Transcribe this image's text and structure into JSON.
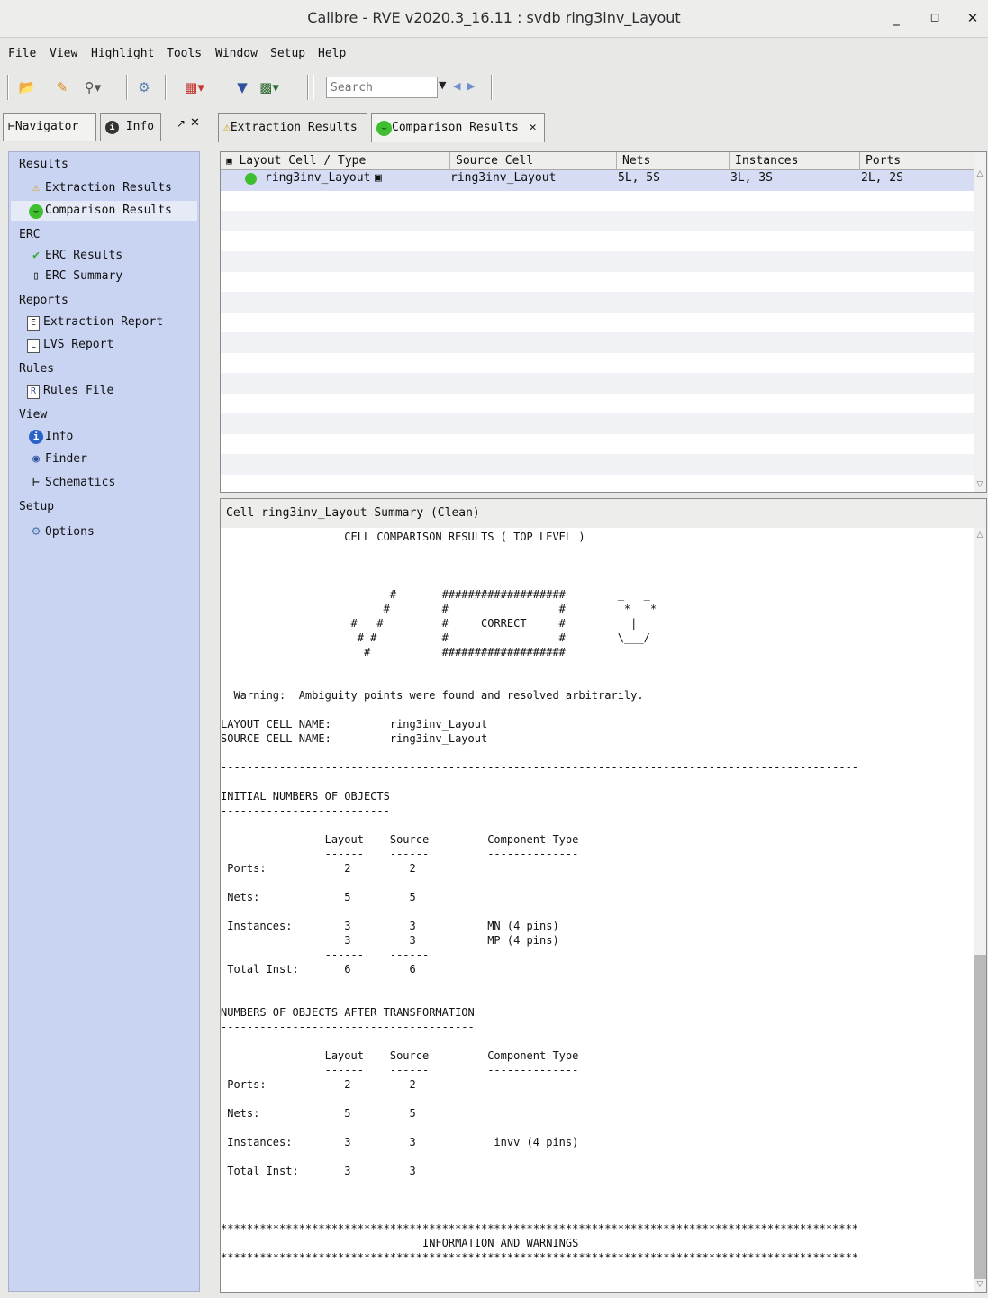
{
  "window": {
    "title": "Calibre - RVE v2020.3_16.11 : svdb ring3inv_Layout",
    "buttons": {
      "minimize": "_",
      "maximize": "◻",
      "close": "✕"
    }
  },
  "menu": [
    "File",
    "View",
    "Highlight",
    "Tools",
    "Window",
    "Setup",
    "Help"
  ],
  "toolbar": {
    "search_placeholder": "Search"
  },
  "left_tabs": {
    "navigator": "Navigator",
    "info": "Info"
  },
  "navigator": {
    "sections": [
      {
        "label": "Results",
        "items": [
          "Extraction Results",
          "Comparison Results"
        ]
      },
      {
        "label": "ERC",
        "items": [
          "ERC Results",
          "ERC Summary"
        ]
      },
      {
        "label": "Reports",
        "items": [
          "Extraction Report",
          "LVS Report"
        ]
      },
      {
        "label": "Rules",
        "items": [
          "Rules File"
        ]
      },
      {
        "label": "View",
        "items": [
          "Info",
          "Finder",
          "Schematics"
        ]
      },
      {
        "label": "Setup",
        "items": [
          "Options"
        ]
      }
    ],
    "selected": "Comparison Results"
  },
  "right_tabs": {
    "extraction": "Extraction Results",
    "comparison": "Comparison Results",
    "close": "✕"
  },
  "table": {
    "columns": [
      "Layout Cell / Type",
      "Source Cell",
      "Nets",
      "Instances",
      "Ports"
    ],
    "rows": [
      {
        "layout_cell": "ring3inv_Layout",
        "source_cell": "ring3inv_Layout",
        "nets": "5L, 5S",
        "instances": "3L, 3S",
        "ports": "2L, 2S"
      }
    ]
  },
  "summary": {
    "header": "Cell ring3inv_Layout Summary (Clean)",
    "report_text": "                   CELL COMPARISON RESULTS ( TOP LEVEL )\n\n\n\n                          #       ###################        _   _\n                         #        #                 #         *   *\n                    #   #         #     CORRECT     #          |\n                     # #          #                 #        \\___/\n                      #           ###################\n\n\n  Warning:  Ambiguity points were found and resolved arbitrarily.\n\nLAYOUT CELL NAME:         ring3inv_Layout\nSOURCE CELL NAME:         ring3inv_Layout\n\n--------------------------------------------------------------------------------------------------\n\nINITIAL NUMBERS OF OBJECTS\n--------------------------\n\n                Layout    Source         Component Type\n                ------    ------         --------------\n Ports:            2         2\n\n Nets:             5         5\n\n Instances:        3         3           MN (4 pins)\n                   3         3           MP (4 pins)\n                ------    ------\n Total Inst:       6         6\n\n\nNUMBERS OF OBJECTS AFTER TRANSFORMATION\n---------------------------------------\n\n                Layout    Source         Component Type\n                ------    ------         --------------\n Ports:            2         2\n\n Nets:             5         5\n\n Instances:        3         3           _invv (4 pins)\n                ------    ------\n Total Inst:       3         3\n\n\n\n**************************************************************************************************\n                               INFORMATION AND WARNINGS\n**************************************************************************************************"
  },
  "colors": {
    "nav_bg": "#c9d3f2",
    "selected_row": "#d6dcf3",
    "status_ok": "#3fbf2f"
  }
}
